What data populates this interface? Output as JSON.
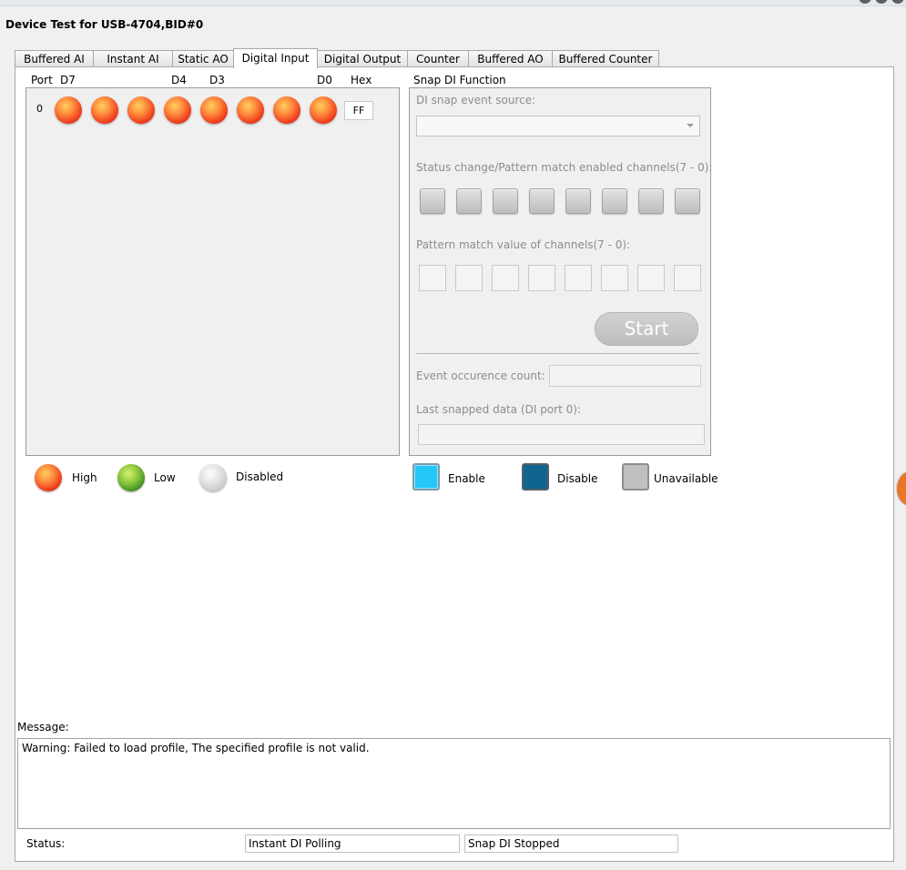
{
  "window": {
    "title": "Device Test for USB-4704,BID#0"
  },
  "tabs": [
    {
      "label": "Buffered AI"
    },
    {
      "label": "Instant AI"
    },
    {
      "label": "Static AO"
    },
    {
      "label": "Digital Input"
    },
    {
      "label": "Digital Output"
    },
    {
      "label": "Counter"
    },
    {
      "label": "Buffered AO"
    },
    {
      "label": "Buffered Counter"
    }
  ],
  "active_tab": "Digital Input",
  "di": {
    "header": {
      "port": "Port",
      "d7": "D7",
      "d4": "D4",
      "d3": "D3",
      "d0": "D0",
      "hex": "Hex"
    },
    "port_number": "0",
    "bits": [
      "High",
      "High",
      "High",
      "High",
      "High",
      "High",
      "High",
      "High"
    ],
    "hex_value": "FF"
  },
  "snap": {
    "title": "Snap DI Function",
    "event_source_label": "DI snap event source:",
    "event_source_value": "",
    "enabled_channels_label": "Status change/Pattern match enabled channels(7 - 0):",
    "pattern_label": "Pattern match value of channels(7 - 0):",
    "start_label": "Start",
    "count_label": "Event occurence count:",
    "count_value": "",
    "last_label": "Last snapped data (DI port 0):",
    "last_value": ""
  },
  "legend": {
    "high": "High",
    "low": "Low",
    "disabled": "Disabled",
    "enable": "Enable",
    "disable": "Disable",
    "unavailable": "Unavailable"
  },
  "message": {
    "label": "Message:",
    "text": "Warning: Failed to load profile, The specified profile is not valid."
  },
  "status": {
    "label": "Status:",
    "instant": "Instant DI Polling",
    "snap": "Snap DI  Stopped"
  },
  "colors": {
    "led_high": "#ef3a1c",
    "led_low": "#3e8e25",
    "led_disabled": "#c2c2c2",
    "enable": "#23c8f8",
    "disable": "#0f6590",
    "unavailable": "#c0c0c0"
  }
}
